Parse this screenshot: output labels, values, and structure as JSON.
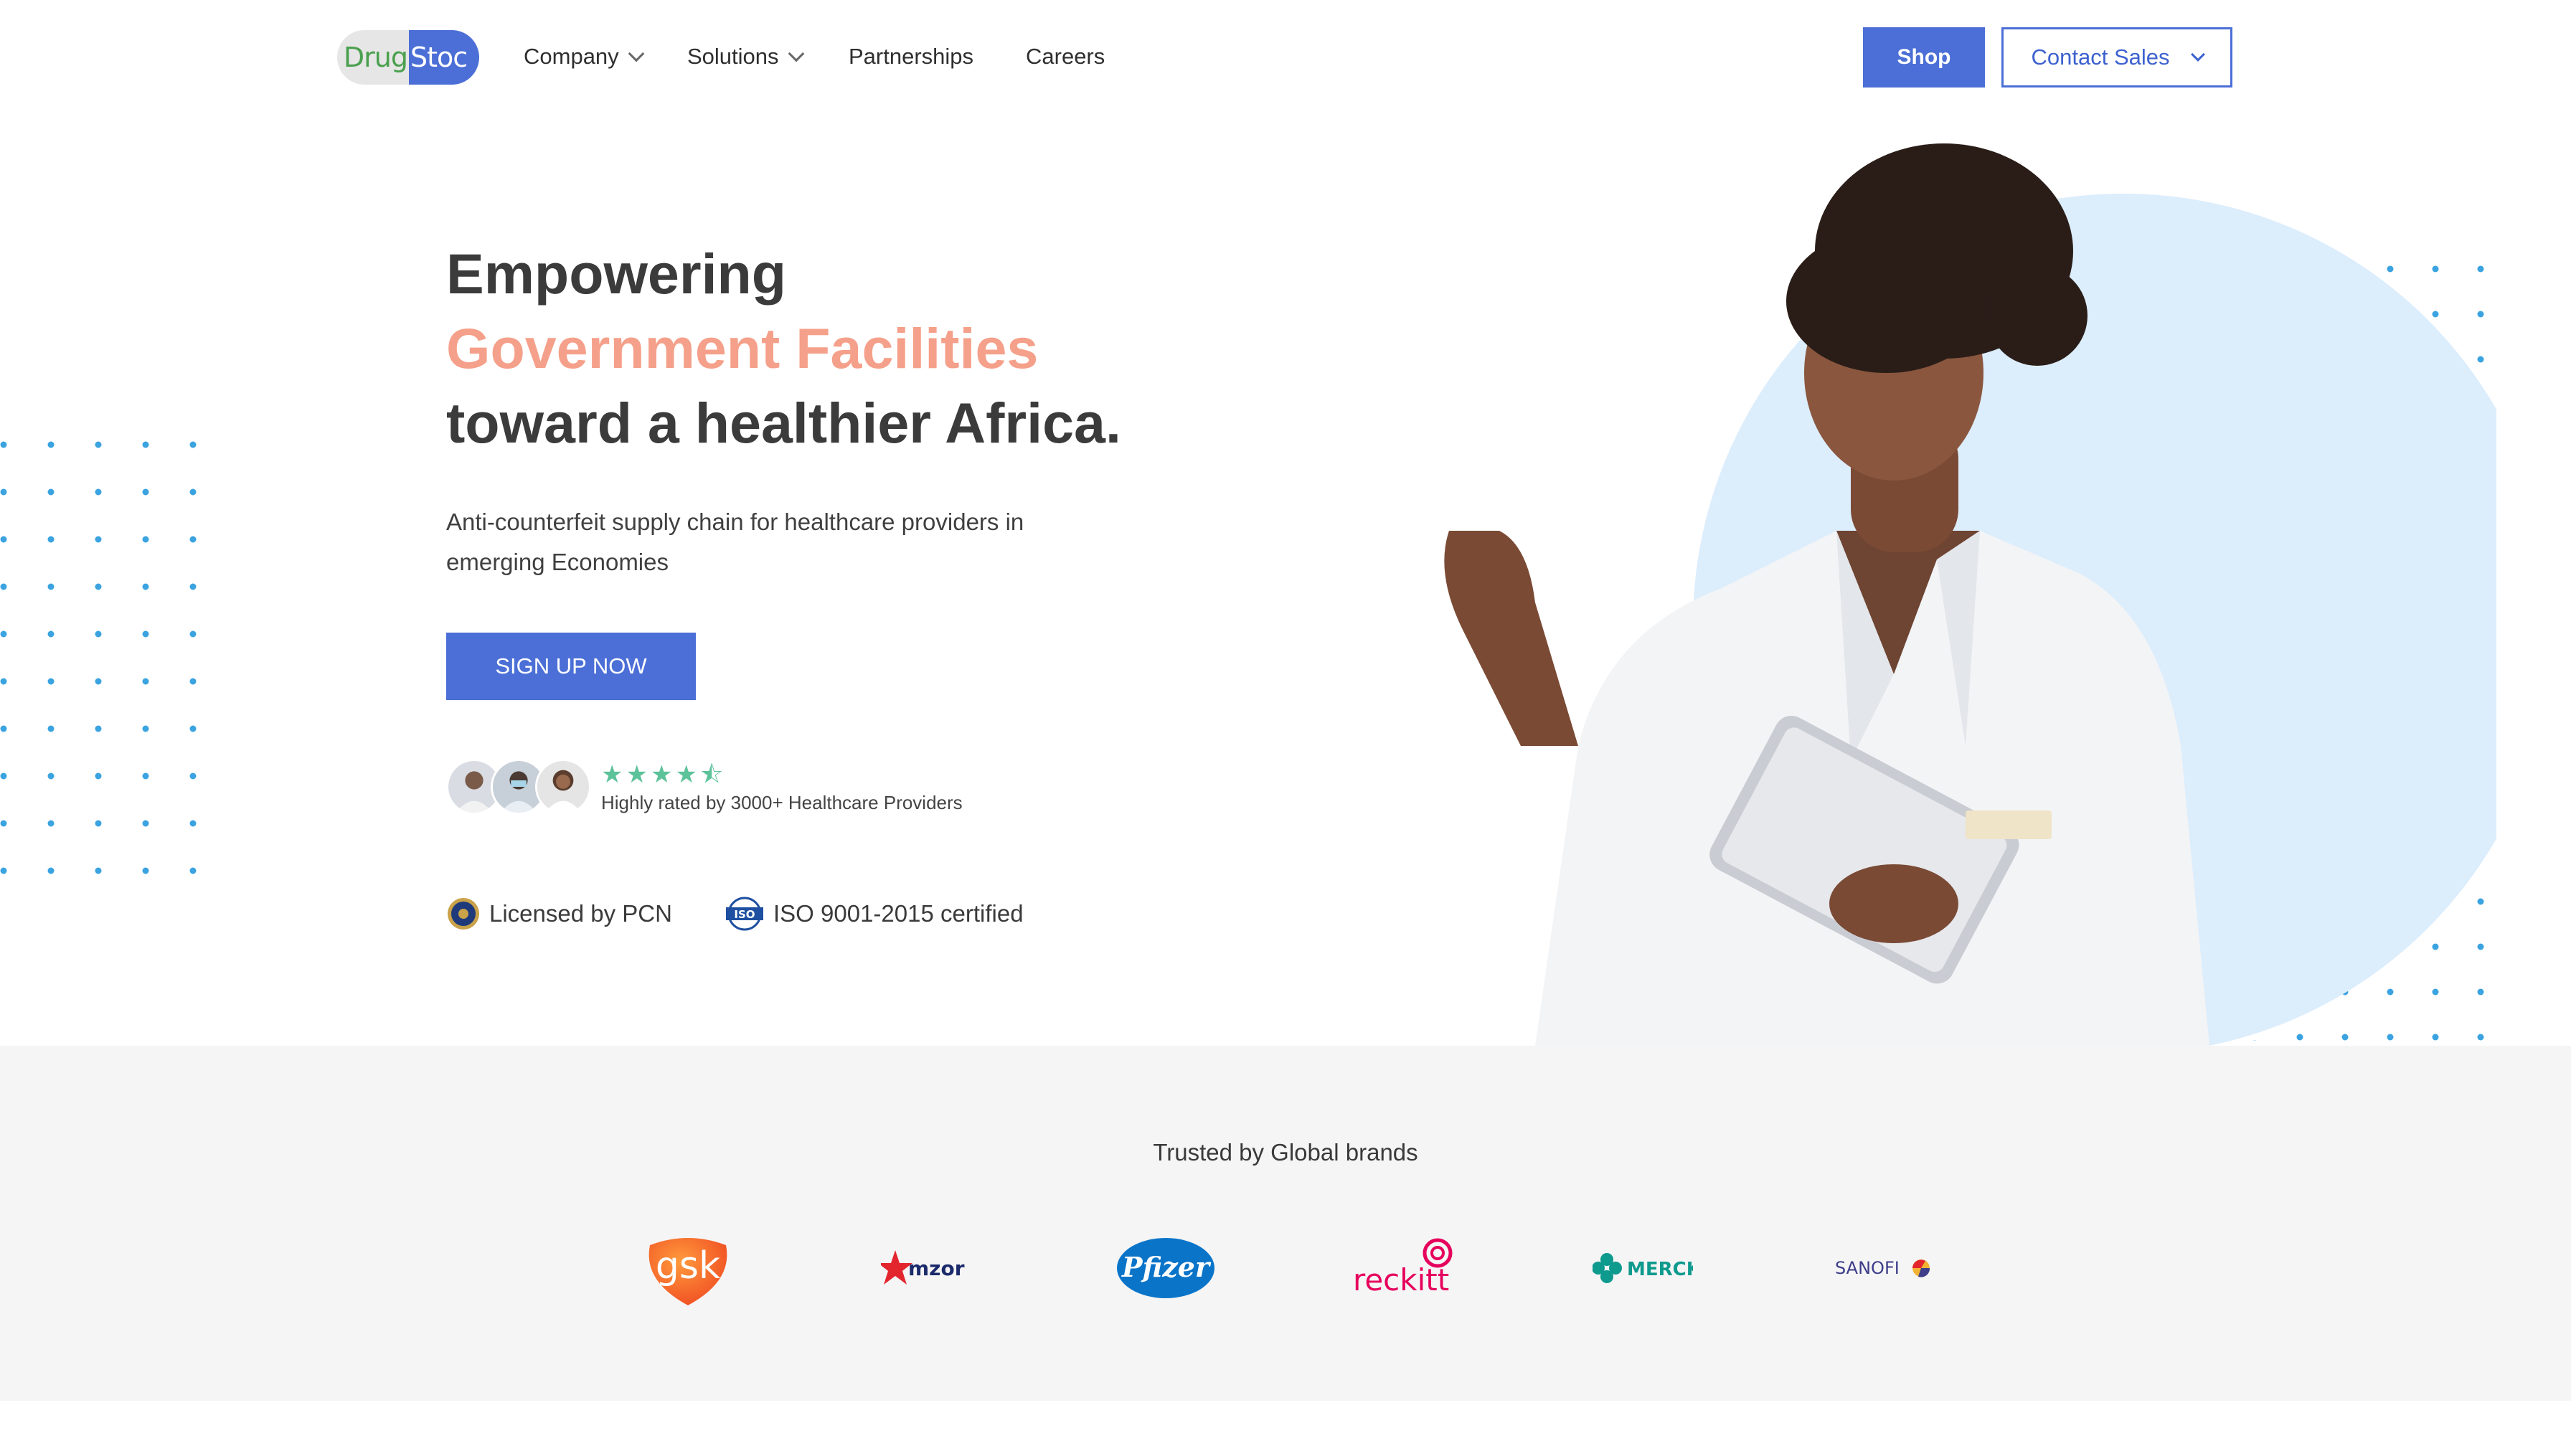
{
  "nav": {
    "logo": {
      "part1": "Drug",
      "part2": "Stoc"
    },
    "items": [
      {
        "label": "Company",
        "has_dropdown": true
      },
      {
        "label": "Solutions",
        "has_dropdown": true
      },
      {
        "label": "Partnerships",
        "has_dropdown": false
      },
      {
        "label": "Careers",
        "has_dropdown": false
      }
    ],
    "shop_label": "Shop",
    "contact_label": "Contact Sales"
  },
  "hero": {
    "title_line1": "Empowering",
    "title_line2": "Government Facilities",
    "title_line3": "toward a healthier Africa.",
    "subtitle": "Anti-counterfeit supply chain for healthcare providers in emerging Economies",
    "cta_label": "SIGN UP NOW",
    "rating": 4.5,
    "stars": "★★★★⯪",
    "rating_text": "Highly rated by 3000+ Healthcare Providers",
    "badges": [
      {
        "icon": "pcn-seal-icon",
        "label": "Licensed by PCN"
      },
      {
        "icon": "iso-logo-icon",
        "label": "ISO 9001-2015 certified"
      }
    ]
  },
  "trusted": {
    "title": "Trusted by Global brands",
    "brands": [
      {
        "name": "gsk",
        "color": "#f36633"
      },
      {
        "name": "mzor",
        "color": "#1b2a6b"
      },
      {
        "name": "Pfizer",
        "color": "#0a74c9"
      },
      {
        "name": "reckitt",
        "color": "#e6005c"
      },
      {
        "name": "MERCK",
        "color": "#0f9a8e"
      },
      {
        "name": "SANOFI",
        "color": "#3d3d8a"
      }
    ]
  },
  "colors": {
    "primary": "#4b6fd6",
    "accent": "#f5a08a",
    "stars": "#5cc29a",
    "dots": "#3aa3e0",
    "circle": "#dcedfc"
  }
}
